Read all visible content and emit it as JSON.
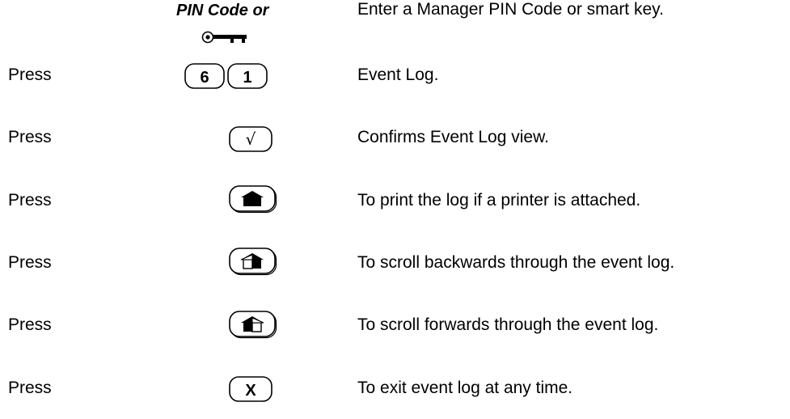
{
  "pin_header": "PIN Code or",
  "rows": [
    {
      "action": "",
      "key": "smart-key",
      "description": "Enter a Manager PIN Code or smart key."
    },
    {
      "action": "Press",
      "key": "6 1",
      "key_labels": [
        "6",
        "1"
      ],
      "description": "Event Log."
    },
    {
      "action": "Press",
      "key": "check",
      "key_label": "√",
      "description": "Confirms Event Log view."
    },
    {
      "action": "Press",
      "key": "print",
      "description": "To print the log if a printer is attached."
    },
    {
      "action": "Press",
      "key": "scroll-back",
      "description": "To scroll backwards through the event log."
    },
    {
      "action": "Press",
      "key": "scroll-forward",
      "description": "To scroll forwards through the event log."
    },
    {
      "action": "Press",
      "key": "exit",
      "key_label": "X",
      "description": "To exit event log at any time."
    }
  ]
}
